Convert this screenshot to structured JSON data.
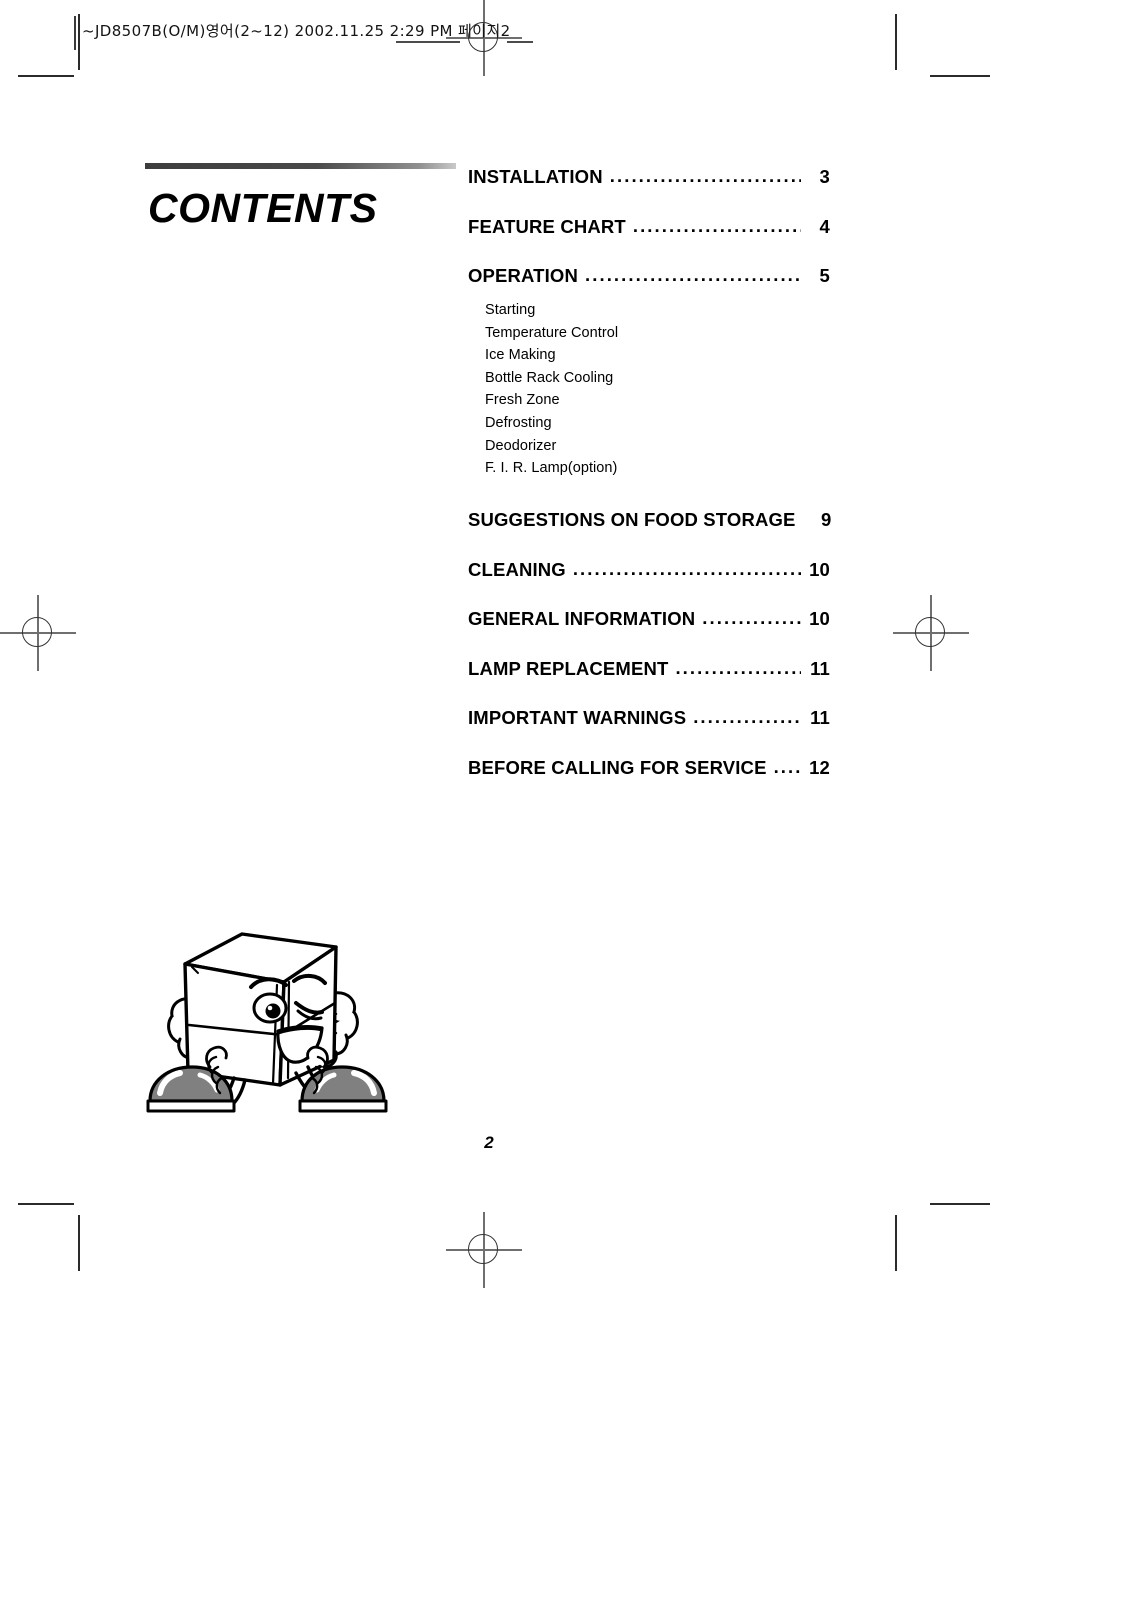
{
  "proof": {
    "header_imprint": "~JD8507B(O/M)영어(2~12)  2002.11.25 2:29 PM 페이지2"
  },
  "heading": {
    "title": "CONTENTS"
  },
  "toc": {
    "entries_primary": [
      {
        "label": "INSTALLATION",
        "leader": "..........................................",
        "page": "3"
      },
      {
        "label": "FEATURE CHART",
        "leader": ".................................",
        "page": "4"
      },
      {
        "label": "OPERATION",
        "leader": "............................................",
        "page": "5"
      }
    ],
    "sub_items": [
      {
        "label": "Starting"
      },
      {
        "label": "Temperature Control"
      },
      {
        "label": "Ice Making"
      },
      {
        "label": "Bottle Rack Cooling"
      },
      {
        "label": "Fresh Zone"
      },
      {
        "label": "Defrosting"
      },
      {
        "label": "Deodorizer"
      },
      {
        "label": "F. I. R. Lamp(option)"
      }
    ],
    "entries_secondary": [
      {
        "label": "SUGGESTIONS ON FOOD STORAGE",
        "leader": "....",
        "page": "9"
      },
      {
        "label": "CLEANING",
        "leader": "..............................................",
        "page": "10"
      },
      {
        "label": "GENERAL INFORMATION",
        "leader": ".......................",
        "page": "10"
      },
      {
        "label": "LAMP REPLACEMENT",
        "leader": "...........................",
        "page": "11"
      },
      {
        "label": "IMPORTANT WARNINGS",
        "leader": "........................",
        "page": "11"
      },
      {
        "label": "BEFORE CALLING FOR SERVICE",
        "leader": ".........",
        "page": "12"
      }
    ]
  },
  "footer": {
    "page_number": "2"
  },
  "colors": {
    "ink": "#000000",
    "bar_dark": "#4a4a4a",
    "bar_light": "#c9c9c9",
    "shoe_grey": "#808080",
    "reg_mark": "#6f6f6f"
  }
}
